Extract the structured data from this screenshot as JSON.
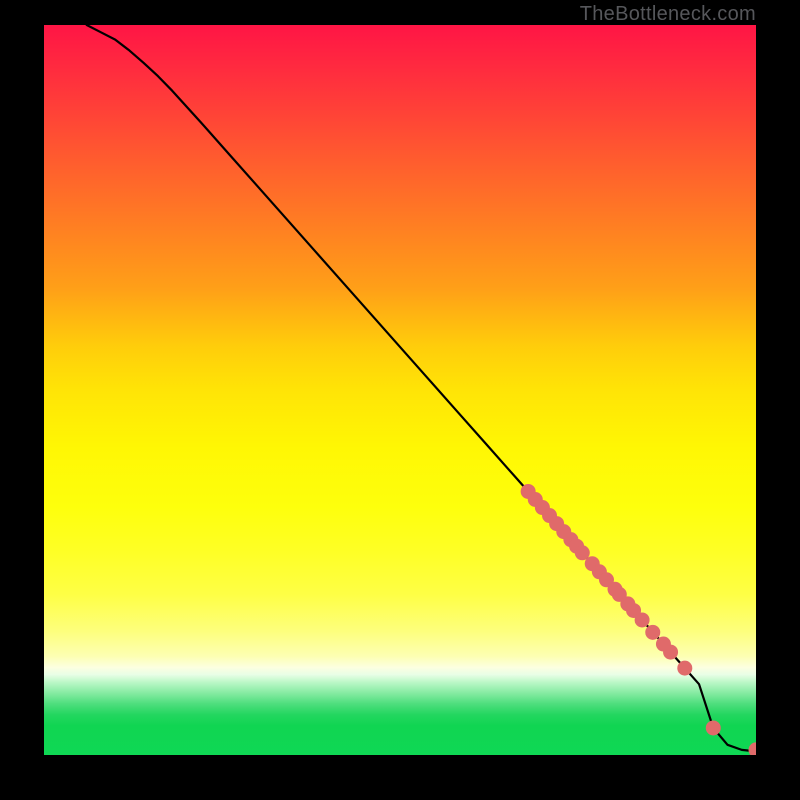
{
  "attribution": "TheBottleneck.com",
  "chart_data": {
    "type": "line",
    "title": "",
    "xlabel": "",
    "ylabel": "",
    "xlim": [
      0,
      100
    ],
    "ylim": [
      0,
      100
    ],
    "grid": false,
    "legend": false,
    "series": [
      {
        "name": "curve",
        "type": "line",
        "x": [
          6,
          8,
          10,
          12,
          14,
          16,
          18,
          22,
          26,
          30,
          34,
          38,
          42,
          46,
          50,
          54,
          58,
          62,
          66,
          70,
          74,
          78,
          82,
          85,
          87,
          89,
          90,
          92,
          94,
          96,
          98,
          100
        ],
        "y": [
          100,
          99,
          98,
          96.5,
          94.8,
          93,
          91,
          86.7,
          82.3,
          77.9,
          73.5,
          69.1,
          64.7,
          60.3,
          55.9,
          51.5,
          47.1,
          42.7,
          38.3,
          33.9,
          29.5,
          25.1,
          20.7,
          17.4,
          15.2,
          13,
          11.9,
          9.7,
          3.7,
          1.4,
          0.7,
          0.5
        ]
      },
      {
        "name": "markers",
        "type": "scatter",
        "x": [
          68,
          69,
          70,
          71,
          72,
          73,
          74,
          74.8,
          75.6,
          77,
          78,
          79,
          80.2,
          80.8,
          82,
          82.8,
          84,
          85.5,
          87,
          88,
          90,
          94,
          100
        ],
        "y": [
          36.1,
          35.0,
          33.9,
          32.8,
          31.7,
          30.6,
          29.5,
          28.6,
          27.7,
          26.2,
          25.1,
          24.0,
          22.7,
          22.0,
          20.7,
          19.8,
          18.5,
          16.8,
          15.2,
          14.1,
          11.9,
          3.7,
          0.7
        ]
      }
    ],
    "colors": {
      "curve": "#000000",
      "markers": "#e06a6a"
    }
  }
}
